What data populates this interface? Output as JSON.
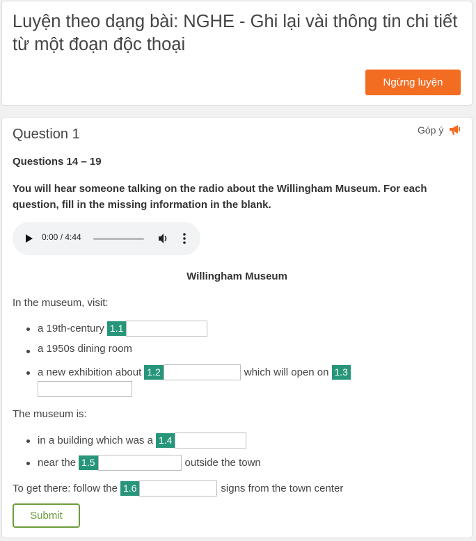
{
  "header": {
    "title": "Luyện theo dạng bài: NGHE - Ghi lại vài thông tin chi tiết từ một đoạn độc thoại",
    "stop_label": "Ngừng luyện"
  },
  "question": {
    "title": "Question 1",
    "feedback_label": "Góp ý",
    "range": "Questions 14 – 19",
    "instructions": "You will hear someone talking on the radio about the Willingham Museum. For each question, fill in the missing information in the blank."
  },
  "audio": {
    "time": "0:00 / 4:44",
    "progress": 0
  },
  "passage": {
    "title": "Willingham Museum",
    "intro1": "In the museum, visit:",
    "item1_text": "a 19th-century",
    "item1_tag": "1.1",
    "item2_text": "a 1950s dining room",
    "item3_text": "a new exhibition about",
    "item3_tag": "1.2",
    "item3_mid": "which will open on",
    "item3_tag2": "1.3",
    "intro2": "The museum is:",
    "item4_text": "in a building which was a",
    "item4_tag": "1.4",
    "item5_text": "near the",
    "item5_tag": "1.5",
    "item5_after": "outside the town",
    "directions_text": "To get there: follow the",
    "directions_tag": "1.6",
    "directions_after": "signs from the town center"
  },
  "answers": {
    "a1": "",
    "a2": "",
    "a3": "",
    "a4": "",
    "a5": "",
    "a6": ""
  },
  "submit_label": "Submit",
  "colors": {
    "accent_orange": "#f26c22",
    "tag_green": "#27957a",
    "submit_green": "#6c9d3a"
  }
}
